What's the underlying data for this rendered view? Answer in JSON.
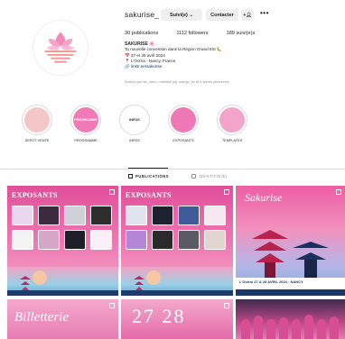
{
  "profile": {
    "username": "sakurise_",
    "follow_label": "Suivi(e) ⌄",
    "contact_label": "Contacter",
    "more_label": "•••",
    "stats": {
      "posts": "30 publications",
      "followers": "1112 followers",
      "following": "189 suivi(e)s"
    },
    "bio": {
      "name": "SAKURISE 🌸",
      "line1": "Ta nouvelle convention dans la Région Grand Est 🐛",
      "line2": "📅 27 et 28 avril 2024",
      "line3": "📍 L'Octroi - Nancy, France",
      "link": "🔗 linktr.ee/sakurise"
    },
    "followed_by": "Suivi(e) par lilu_stmo, mathilde.pql, mango_ko et 3 autres personnes"
  },
  "highlights": [
    {
      "label": "DEPOT VENTE",
      "color": "#f5c6c8",
      "inner_text": "",
      "text_color": "#ffffff"
    },
    {
      "label": "PROGRAMME",
      "color": "#f07ab3",
      "inner_text": "PROGRAMME",
      "text_color": "#ffffff"
    },
    {
      "label": "INFOS",
      "color": "#ffffff",
      "inner_text": "INFOS",
      "text_color": "#262626"
    },
    {
      "label": "EXPOSANTS",
      "color": "#ef79b6",
      "inner_text": "",
      "text_color": "#ffffff"
    },
    {
      "label": "TEMPLATES",
      "color": "#f3a4ca",
      "inner_text": "",
      "text_color": "#ffffff"
    }
  ],
  "tabs": {
    "publications": "PUBLICATIONS",
    "tagged": "IDENTIFIÉ(E)"
  },
  "posts": {
    "exposants_title": "EXPOSANTS",
    "sakurise_title": "Sakurise",
    "sakurise_footer": "L'Octroi   27 & 28 AVRIL 2024 · NANCY",
    "billetterie_title": "Billetterie",
    "dates_title": "27 28"
  },
  "colors": {
    "brand_pink": "#e85ba0",
    "navy": "#19386a"
  }
}
